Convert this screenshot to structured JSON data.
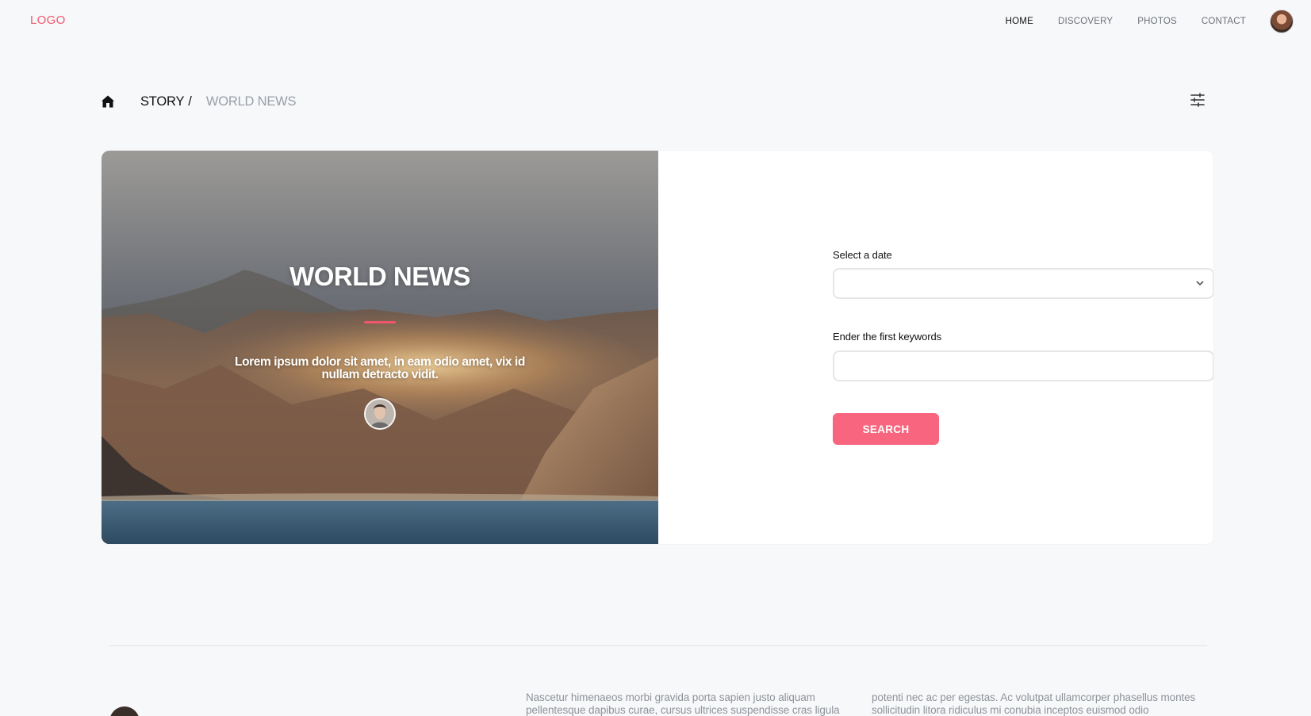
{
  "header": {
    "logo": "LOGO",
    "nav": [
      {
        "label": "HOME",
        "active": true
      },
      {
        "label": "DISCOVERY",
        "active": false
      },
      {
        "label": "PHOTOS",
        "active": false
      },
      {
        "label": "CONTACT",
        "active": false
      }
    ]
  },
  "breadcrumb": {
    "parent": "STORY",
    "separator": "/",
    "current": "WORLD NEWS"
  },
  "hero": {
    "title": "WORLD NEWS",
    "text": "Lorem ipsum dolor sit amet, in eam odio amet, vix id nullam detracto vidit."
  },
  "form": {
    "date_label": "Select a date",
    "date_value": "",
    "keywords_label": "Ender the first keywords",
    "keywords_value": "",
    "search_label": "SEARCH"
  },
  "article": {
    "col1": "Nascetur himenaeos morbi gravida porta sapien justo aliquam pellentesque dapibus curae, cursus ultrices suspendisse cras ligula",
    "col2": "potenti nec ac per egestas. Ac volutpat ullamcorper phasellus montes sollicitudin litora ridiculus mi conubia inceptos euismod odio"
  },
  "colors": {
    "accent": "#f0566e",
    "button": "#f7667e",
    "background": "#f7f8fa"
  },
  "icons": {
    "home": "home-icon",
    "filter": "sliders-icon",
    "chevron": "chevron-down-icon"
  }
}
